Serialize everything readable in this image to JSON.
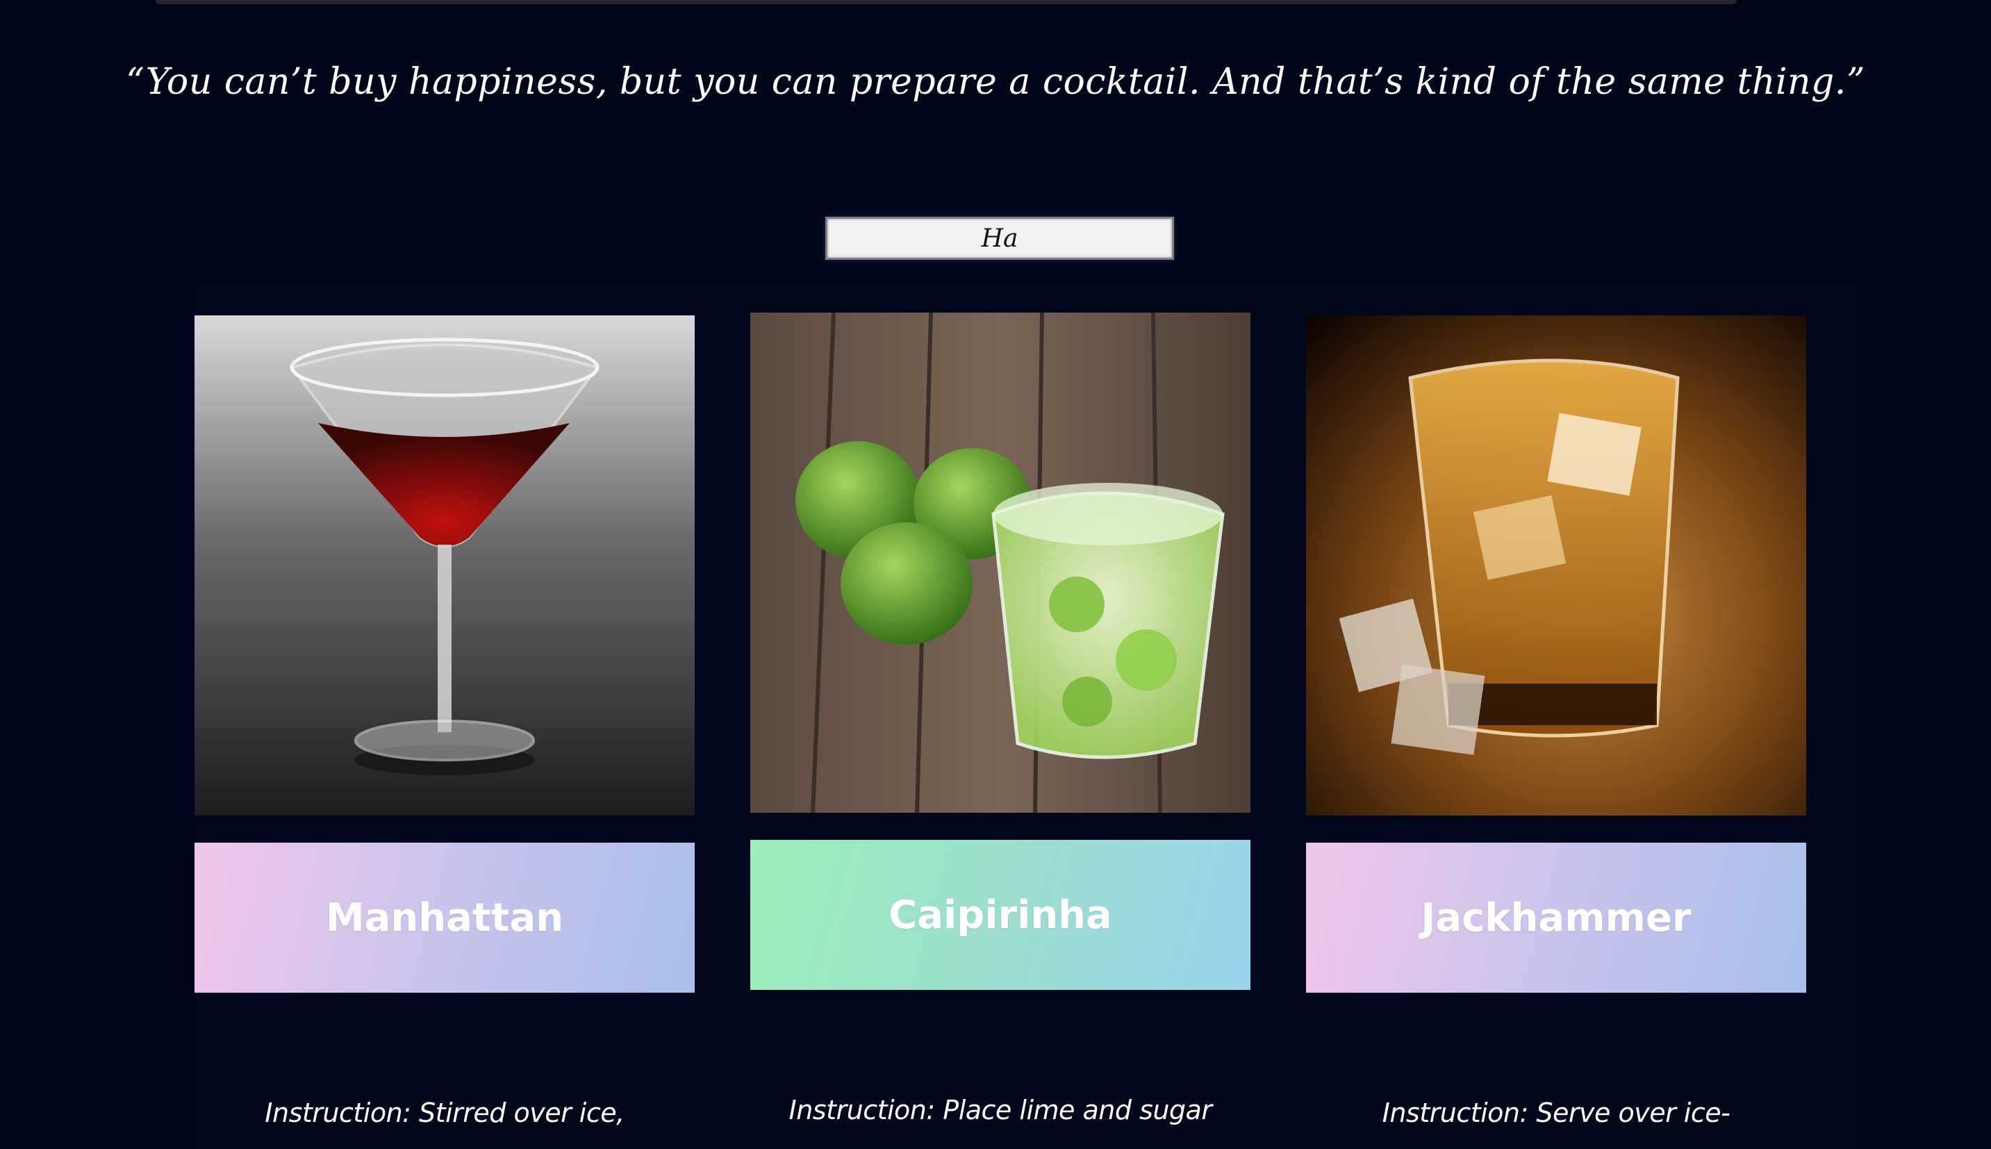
{
  "quote": "“You can’t buy happiness, but you can prepare a cocktail. And that’s kind of the same thing.”",
  "search": {
    "value": "Ha"
  },
  "cocktails": [
    {
      "name": "Manhattan",
      "instruction": "Instruction: Stirred over ice,",
      "image_icon": "martini-glass-image"
    },
    {
      "name": "Caipirinha",
      "instruction": "Instruction: Place lime and sugar",
      "image_icon": "lime-glass-image"
    },
    {
      "name": "Jackhammer",
      "instruction": "Instruction: Serve over ice-",
      "image_icon": "whiskey-glass-image"
    }
  ],
  "colors": {
    "background": "#01061a",
    "title_gradient_pink": [
      "#f0c6e8",
      "#a9bfea"
    ],
    "title_gradient_green": [
      "#9aeeb8",
      "#9ad4ec"
    ]
  }
}
